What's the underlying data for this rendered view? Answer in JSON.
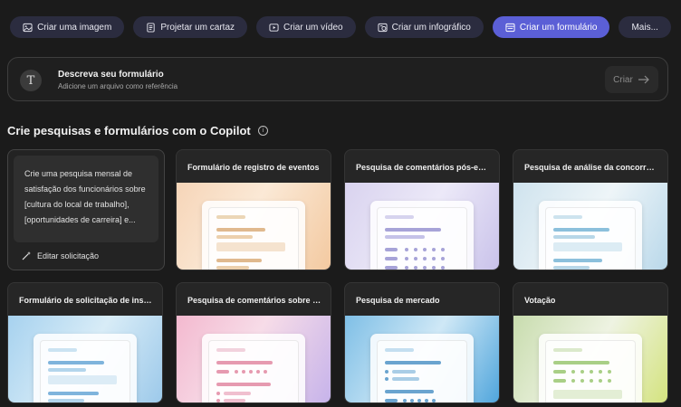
{
  "tabs": [
    {
      "label": "Criar uma imagem",
      "icon": "image-icon",
      "active": false
    },
    {
      "label": "Projetar um cartaz",
      "icon": "poster-icon",
      "active": false
    },
    {
      "label": "Criar um vídeo",
      "icon": "video-icon",
      "active": false
    },
    {
      "label": "Criar um infográfico",
      "icon": "infographic-icon",
      "active": false
    },
    {
      "label": "Criar um formulário",
      "icon": "form-icon",
      "active": true
    },
    {
      "label": "Mais...",
      "icon": "",
      "active": false
    }
  ],
  "prompt": {
    "icon_letter": "T",
    "title": "Descreva seu formulário",
    "subtitle": "Adicione um arquivo como referência",
    "create_label": "Criar"
  },
  "section": {
    "heading": "Crie pesquisas e formulários com o Copilot",
    "info_icon": "i"
  },
  "sample_card": {
    "text": "Crie uma pesquisa mensal de satisfação dos funcionários sobre [cultura do local de trabalho], [oportunidades de carreira] e...",
    "edit_label": "Editar solicitação"
  },
  "templates": [
    {
      "title": "Formulário de registro de eventos",
      "accent": "#e0b98e"
    },
    {
      "title": "Pesquisa de comentários pós-evento",
      "accent": "#a7a3d8"
    },
    {
      "title": "Pesquisa de análise da concorrência",
      "accent": "#8cc0dc"
    },
    {
      "title": "Formulário de solicitação de instalaç...",
      "accent": "#7fb4dc"
    },
    {
      "title": "Pesquisa de comentários sobre o pro...",
      "accent": "#e69ab0"
    },
    {
      "title": "Pesquisa de mercado",
      "accent": "#6aa4cf"
    },
    {
      "title": "Votação",
      "accent": "#a9cf86"
    }
  ]
}
